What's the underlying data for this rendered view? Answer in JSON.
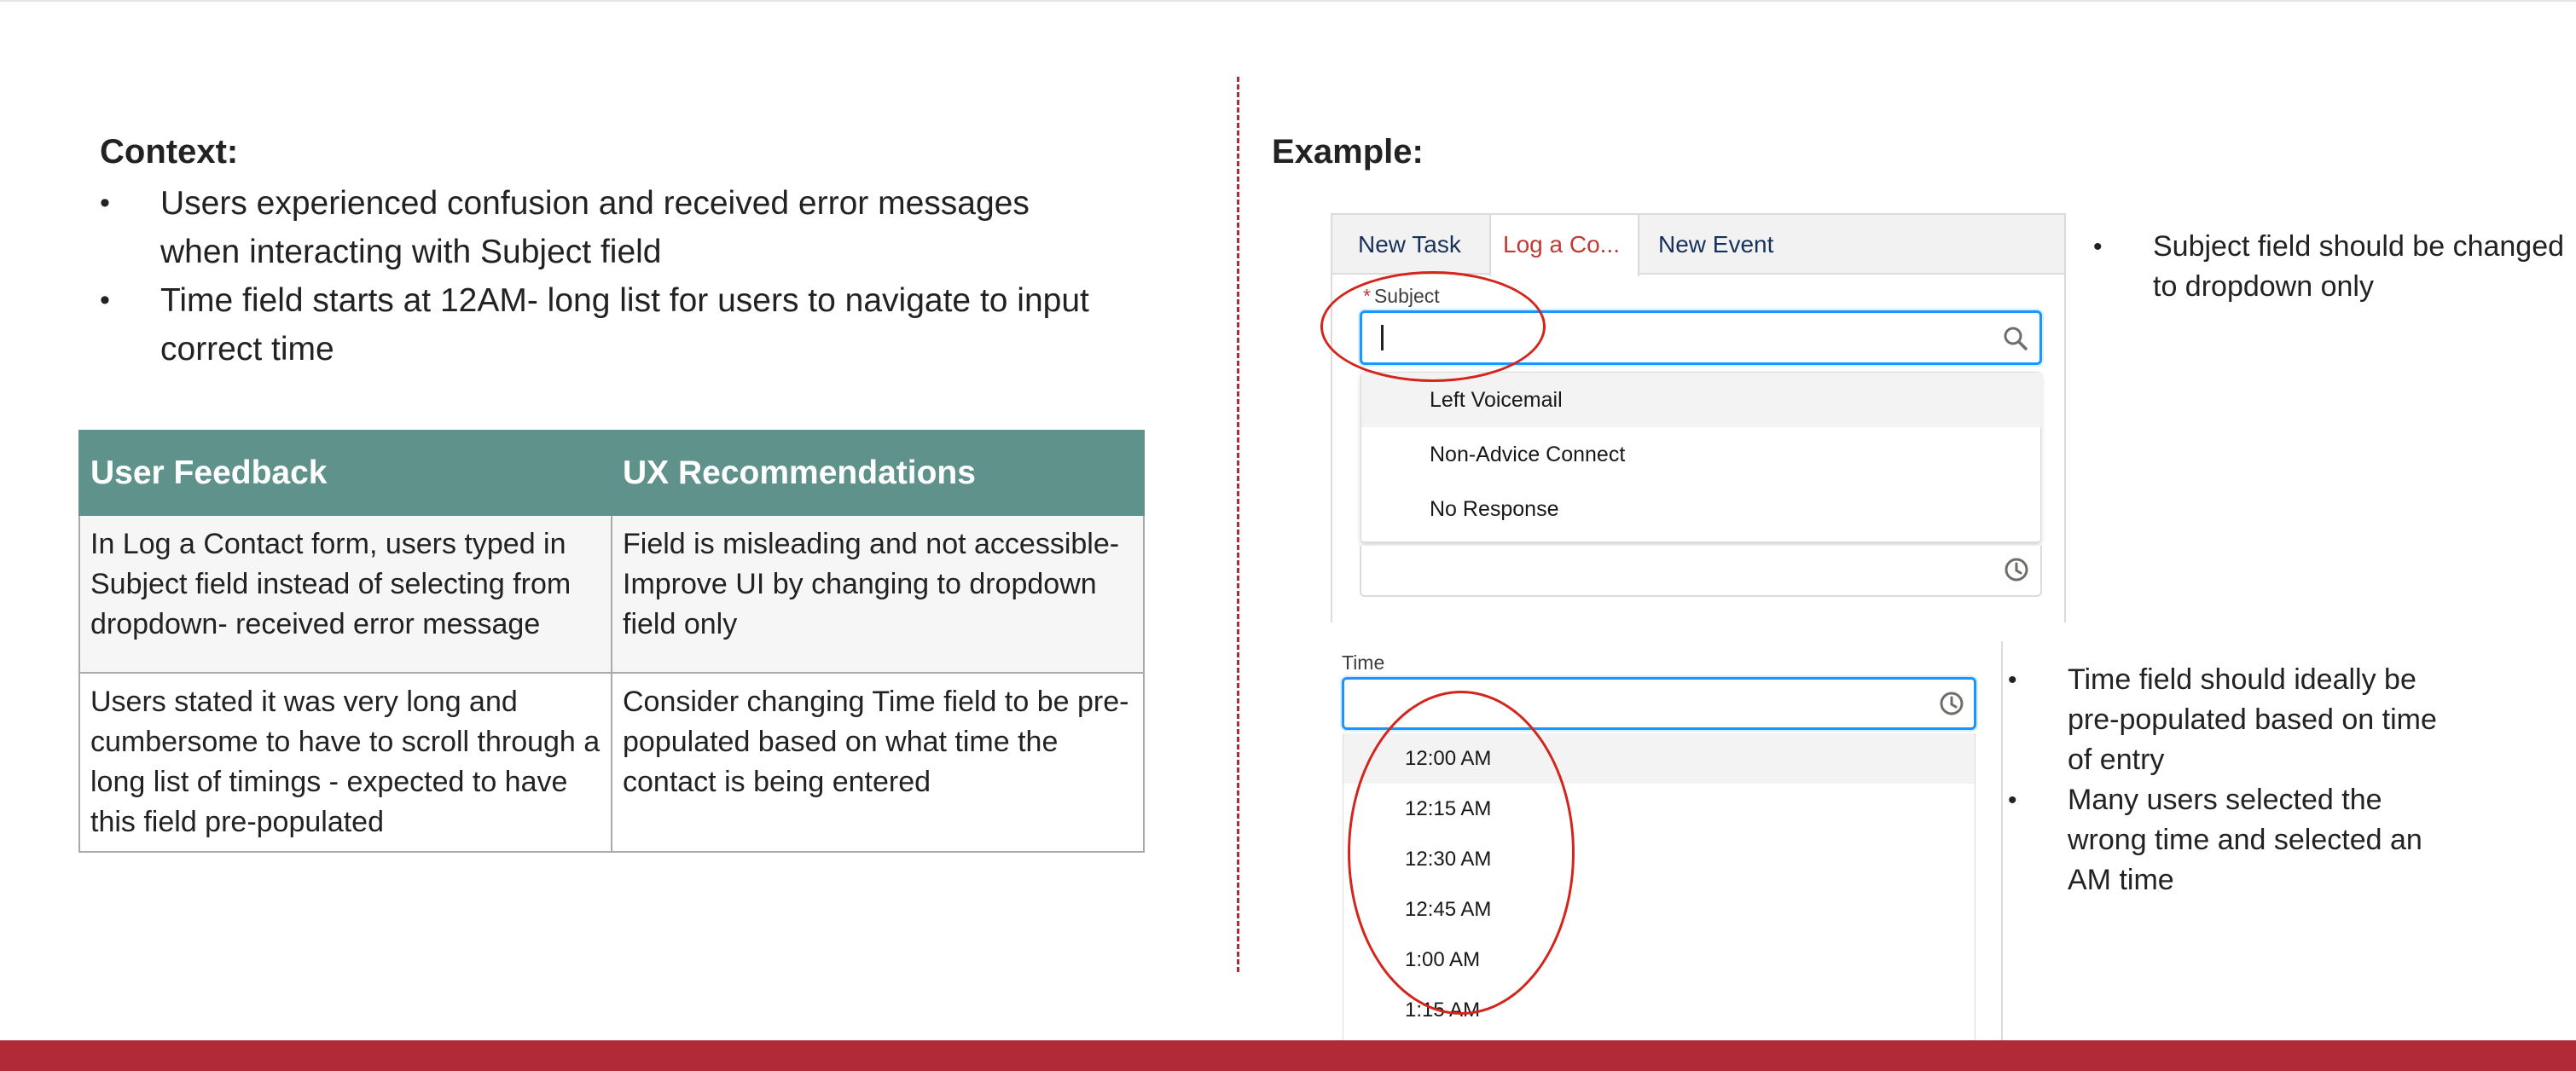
{
  "context": {
    "title": "Context:",
    "bullets": [
      "Users experienced confusion and received error messages when interacting with Subject field",
      "Time field starts at 12AM- long list for users to navigate to input correct time"
    ]
  },
  "table": {
    "headers": [
      "User Feedback",
      "UX Recommendations"
    ],
    "rows": [
      [
        "In Log a Contact form, users typed in Subject field instead of selecting from dropdown- received error message",
        "Field is misleading and not accessible- Improve UI by changing to dropdown field only"
      ],
      [
        "Users stated it was very long and cumbersome to have to scroll through a long list of timings - expected to have this field pre-populated",
        "Consider changing Time field to be pre-populated based on what time the contact is being entered"
      ]
    ]
  },
  "example": {
    "title": "Example:",
    "tabs": [
      "New Task",
      "Log a Co...",
      "New Event"
    ],
    "subject_required_mark": "*",
    "subject_label": "Subject",
    "subject_value": "",
    "subject_options": [
      "Left Voicemail",
      "Non-Advice Connect",
      "No Response"
    ],
    "time_label": "Time",
    "time_value": "",
    "time_options": [
      "12:00 AM",
      "12:15 AM",
      "12:30 AM",
      "12:45 AM",
      "1:00 AM",
      "1:15 AM"
    ]
  },
  "notes": {
    "subject": [
      "Subject field should be changed to dropdown only"
    ],
    "time": [
      "Time field should ideally be pre-populated based on time of entry",
      "Many users selected the wrong time and selected an AM time"
    ]
  },
  "colors": {
    "table_header": "#5f928b",
    "accent_red": "#b02a37",
    "annotation_red": "#d4251c",
    "focus_blue": "#1b96ff"
  },
  "icons": [
    "search-icon",
    "clock-icon"
  ],
  "bullet_glyph": "•"
}
